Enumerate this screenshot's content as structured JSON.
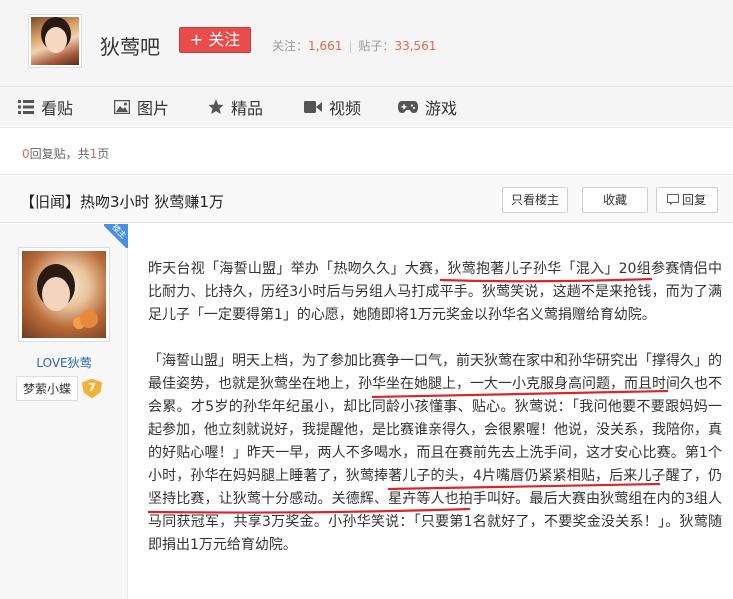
{
  "header": {
    "forum_name": "狄莺吧",
    "follow_label": "+ 关注",
    "followers_label": "关注：",
    "followers_count": "1,661",
    "posts_label": "贴子：",
    "posts_count": "33,561"
  },
  "nav": {
    "items": [
      {
        "label": "看贴",
        "icon": "list-icon"
      },
      {
        "label": "图片",
        "icon": "image-icon"
      },
      {
        "label": "精品",
        "icon": "star-icon"
      },
      {
        "label": "视频",
        "icon": "video-icon"
      },
      {
        "label": "游戏",
        "icon": "gamepad-icon"
      }
    ]
  },
  "reply_info": {
    "count": "0",
    "middle": "回复贴，共",
    "pages": "1",
    "suffix": "页"
  },
  "thread": {
    "title": "【旧闻】热吻3小时 狄莺赚1万",
    "only_author_label": "只看楼主",
    "favorite_label": "收藏",
    "reply_label": "回复"
  },
  "author": {
    "badge": "楼主",
    "name": "LOVE狄莺",
    "rank_name": "梦萦小蝶",
    "rank_level": "7"
  },
  "post": {
    "paragraphs": [
      "昨天台视「海誓山盟」举办「热吻久久」大赛，狄莺抱著儿子孙华「混入」20组参赛情侣中比耐力、比持久，历经3小时后与另组人马打成平手。狄莺笑说，这趟不是来抢钱，而为了满足儿子「一定要得第1」的心愿，她随即将1万元奖金以孙华名义莺捐赠给育幼院。",
      "「海誓山盟」明天上档，为了参加比赛争一口气，前天狄莺在家中和孙华研究出「撑得久」的最佳姿势，也就是狄莺坐在地上，孙华坐在她腿上，一大一小克服身高问题，而且时间久也不会累。才5岁的孙华年纪虽小，却比同龄小孩懂事、贴心。狄莺说：「我问他要不要跟妈妈一起参加，他立刻就说好，我提醒他，是比赛谁亲得久，会很累喔！他说，没关系，我陪你，真的好贴心喔！」昨天一早，两人不多喝水，而且在赛前先去上洗手间，这才安心比赛。第1个小时，孙华在妈妈腿上睡著了，狄莺捧著儿子的头，4片嘴唇仍紧紧相贴，后来儿子醒了，仍坚持比赛，让狄莺十分感动。关德辉、星卉等人也拍手叫好。最后大赛由狄莺组在内的3组人马同获冠军，共享3万奖金。小孙华笑说：「只要第1名就好了，不要奖金没关系！」。狄莺随即捐出1万元给育幼院。"
    ]
  },
  "colors": {
    "follow_button": "#e84c4c",
    "count_highlight": "#e36a4d",
    "author_link": "#2d64b3",
    "badge_blue": "#4a90e2",
    "underline_red": "#d8262a"
  }
}
